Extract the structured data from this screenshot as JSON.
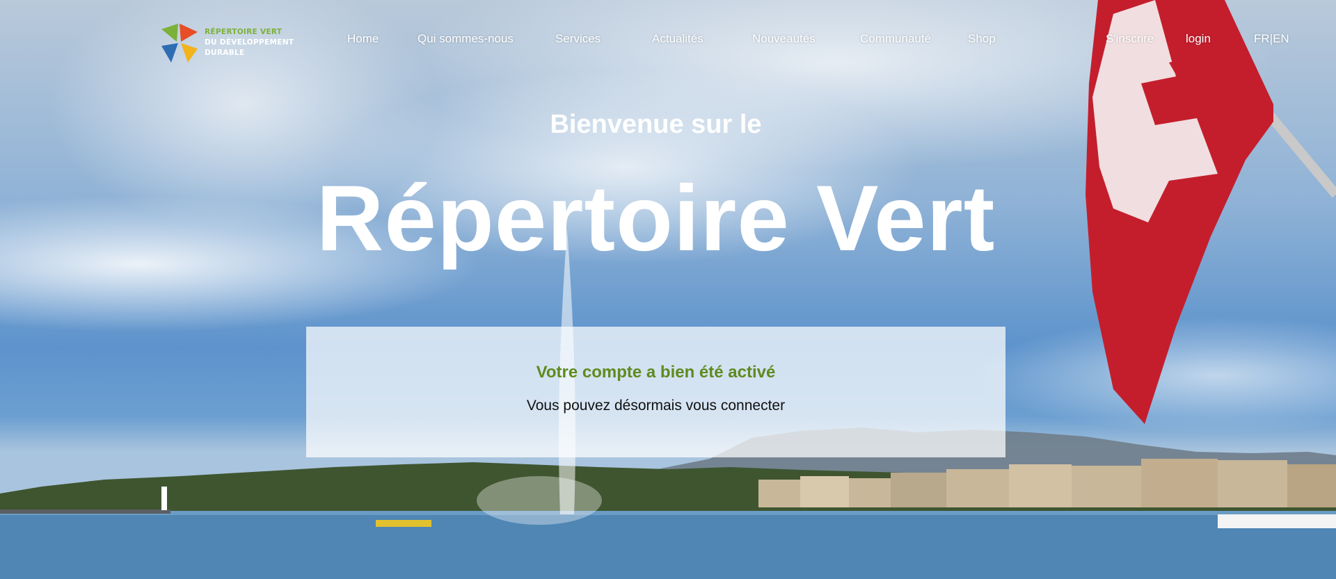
{
  "brand": {
    "logo_lines": [
      "RÉPERTOIRE VERT",
      "DU DÉVELOPPEMENT",
      "DURABLE"
    ],
    "logo_colors": [
      "#7cb13a",
      "#e74d26",
      "#f2b31c",
      "#2f6db3"
    ]
  },
  "nav": {
    "items": [
      {
        "label": "Home"
      },
      {
        "label": "Qui sommes-nous"
      },
      {
        "label": "Services"
      },
      {
        "label": "Actualités"
      },
      {
        "label": "Nouveautés"
      },
      {
        "label": "Communauté"
      },
      {
        "label": "Shop"
      }
    ],
    "signup": "S'inscrire",
    "login": "login",
    "lang": "FR|EN"
  },
  "hero": {
    "welcome": "Bienvenue sur le",
    "title": "Répertoire Vert"
  },
  "message": {
    "title": "Votre compte a bien été activé",
    "text": "Vous pouvez désormais vous connecter",
    "title_color": "#5e8b1f"
  }
}
